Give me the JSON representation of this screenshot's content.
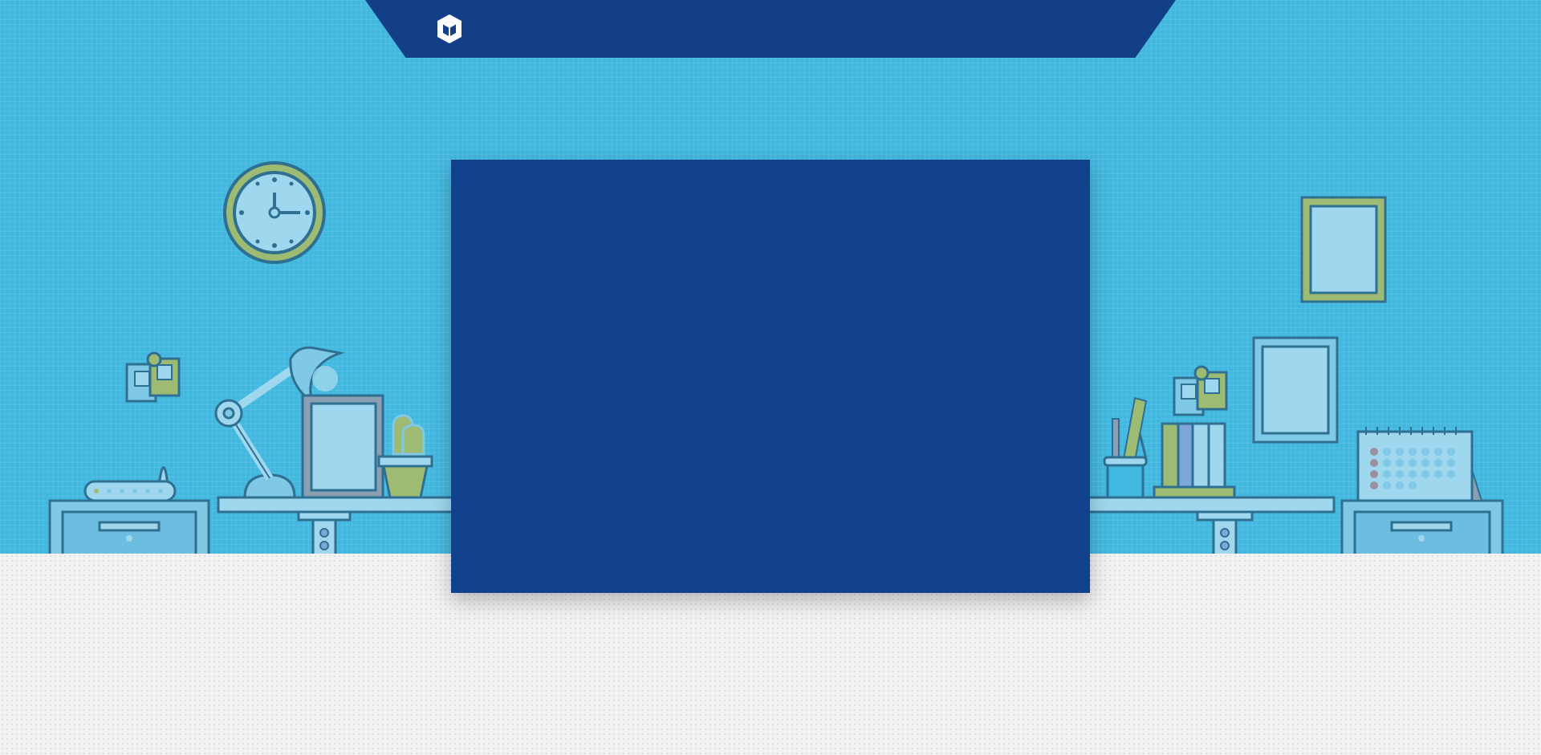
{
  "app": {
    "logo_icon": "cube-logo-icon"
  },
  "scene": {
    "clock_icon": "wall-clock-icon",
    "desk_lamp_icon": "desk-lamp-icon",
    "plant_icon": "cactus-pot-icon",
    "router_icon": "wifi-router-icon",
    "books_icon": "books-icon",
    "pencil_cup_icon": "pencil-cup-icon",
    "calendar_icon": "desk-calendar-icon"
  },
  "colors": {
    "wall": "#41b8e0",
    "banner": "#123f86",
    "panel": "#12418b",
    "floor": "#f2f2f2",
    "accent_green": "#9dbb73",
    "line_dark": "#2e6f92"
  }
}
